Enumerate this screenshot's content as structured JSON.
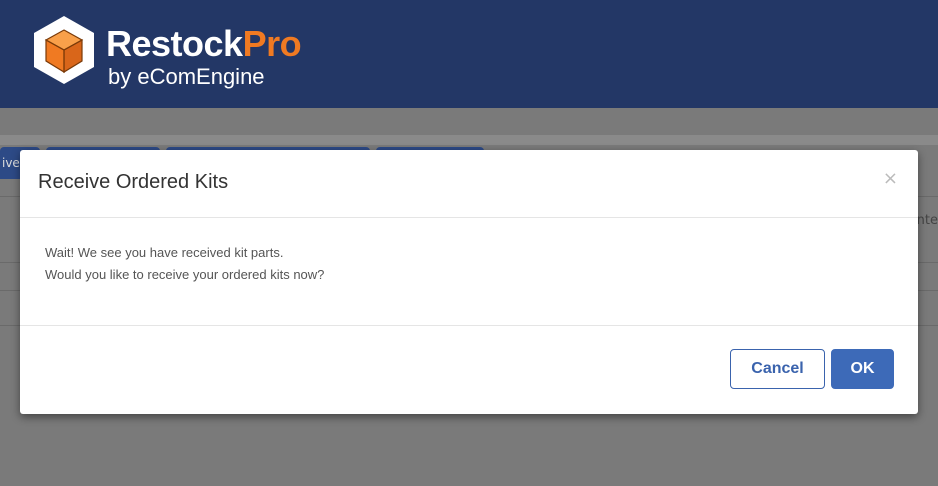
{
  "app": {
    "brand_main": "Restock",
    "brand_accent": "Pro",
    "byline": "by eComEngine",
    "brand_color": "#233766",
    "accent_color": "#f07a22",
    "logo_icon": "box-hex-icon"
  },
  "background": {
    "tab_fragment": "ive",
    "right_fragment": "nte"
  },
  "dialog": {
    "title": "Receive Ordered Kits",
    "close_label": "×",
    "message_line1": "Wait! We see you have received kit parts.",
    "message_line2": "Would you like to receive your ordered kits now?",
    "cancel_label": "Cancel",
    "ok_label": "OK",
    "primary_color": "#3d6ab8"
  }
}
